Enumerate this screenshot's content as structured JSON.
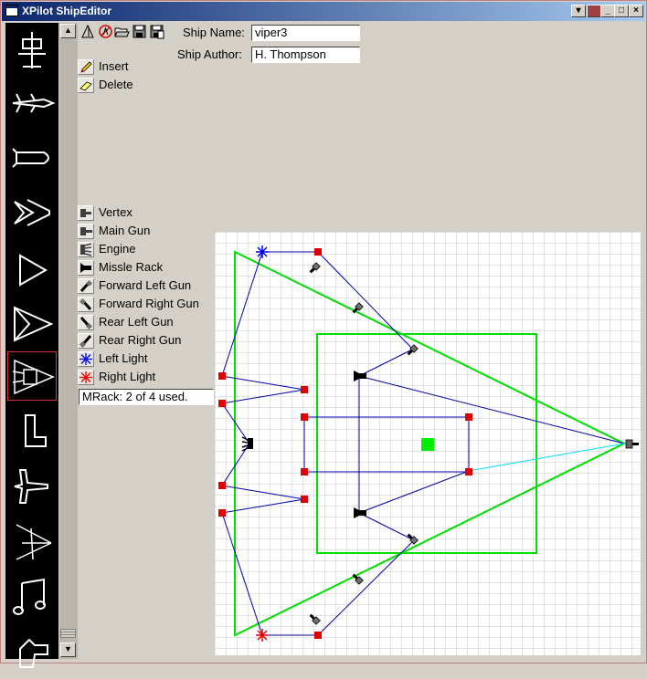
{
  "window": {
    "title": "XPilot ShipEditor",
    "controls": {
      "menu": "▾",
      "minimize": "_",
      "maximize": "□",
      "close": "×"
    }
  },
  "sidebar": {
    "ships": [
      {
        "name": "ship-1"
      },
      {
        "name": "ship-2"
      },
      {
        "name": "ship-3"
      },
      {
        "name": "ship-4"
      },
      {
        "name": "ship-5"
      },
      {
        "name": "ship-6"
      },
      {
        "name": "ship-7-viper3",
        "selected": true
      },
      {
        "name": "ship-8"
      },
      {
        "name": "ship-9"
      },
      {
        "name": "ship-10"
      },
      {
        "name": "ship-11"
      },
      {
        "name": "ship-12"
      }
    ]
  },
  "toolbar": {
    "icons": [
      "triangle-tool-icon",
      "no-symbol-icon",
      "open-folder-icon",
      "save-icon",
      "save-as-icon"
    ]
  },
  "form": {
    "ship_name_label": "Ship Name:",
    "ship_name_value": "viper3",
    "ship_author_label": "Ship Author:",
    "ship_author_value": "H. Thompson"
  },
  "modes": [
    {
      "label": "Insert",
      "icon": "pencil-icon"
    },
    {
      "label": "Delete",
      "icon": "eraser-icon"
    }
  ],
  "parts": [
    {
      "label": "Vertex",
      "icon": "vertex-icon"
    },
    {
      "label": "Main Gun",
      "icon": "main-gun-icon"
    },
    {
      "label": "Engine",
      "icon": "engine-icon"
    },
    {
      "label": "Missle Rack",
      "icon": "missile-rack-icon"
    },
    {
      "label": "Forward Left Gun",
      "icon": "forward-left-gun-icon"
    },
    {
      "label": "Forward Right Gun",
      "icon": "forward-right-gun-icon"
    },
    {
      "label": "Rear Left Gun",
      "icon": "rear-left-gun-icon"
    },
    {
      "label": "Rear Right Gun",
      "icon": "rear-right-gun-icon"
    },
    {
      "label": "Left Light",
      "icon": "left-light-icon"
    },
    {
      "label": "Right Light",
      "icon": "right-light-icon"
    }
  ],
  "status": "MRack: 2 of 4 used.",
  "colors": {
    "outline": "#00dd00",
    "wire": "#0000aa",
    "vertex": "#e00000",
    "main_gun_link": "#00e0ff",
    "grid": "#c8c8c8",
    "center": "#00ee00"
  }
}
